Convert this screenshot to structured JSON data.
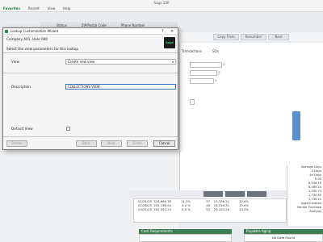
{
  "app": {
    "title": "Sage 100",
    "menu": [
      "Favorites",
      "Recent",
      "View",
      "Help"
    ],
    "active_menu": "Favorites"
  },
  "background": {
    "columns": [
      "Status",
      "ZIP/Postal Code",
      "Phone Number"
    ],
    "toolbar_buttons": [
      "Copy From",
      "Renumber",
      "Next"
    ],
    "section_label": "Transactions",
    "section_label2": "SOs",
    "side_values": [
      "Average Days",
      "0 Days",
      "All Days",
      "0.00",
      "8,546.16",
      "6,089.24",
      "1,330.74",
      "1,730.40",
      "1,734.40",
      "Aged Invoices",
      "Vendor Purchase Analysis"
    ],
    "table_rows": [
      [
        "01/31/25",
        "324,669.16",
        "11.2%",
        "37",
        "15,156.21",
        "12.4%"
      ],
      [
        "02/28/25",
        "205,198.94",
        "4.0 %",
        "46",
        "16,518.31",
        "13.4%"
      ],
      [
        "03/31/25",
        "187,492.23",
        "4.0 %",
        "52",
        "29,433.26",
        "23.4%"
      ]
    ],
    "bottom_left_panel": "Cash Requirements",
    "bottom_right_panel": "Payables Aging",
    "no_data": "No Data Found",
    "bar_label": "0/31"
  },
  "dialog": {
    "title": "Lookup Customization Wizard",
    "help_symbol": "?",
    "close_symbol": "×",
    "company_line": "Company A01, User 000",
    "instruction": "Select the view parameters for this lookup",
    "logo_text": "Sage",
    "view": {
      "label": "View",
      "value": "Create new view"
    },
    "description": {
      "label": "Description",
      "value": "COLLECTIONS VIEW"
    },
    "default_view": {
      "label": "Default View",
      "checked": false
    },
    "buttons": {
      "delete": "Delete",
      "back": "Back",
      "next": "Next",
      "finish": "Finish",
      "cancel": "Cancel"
    }
  }
}
